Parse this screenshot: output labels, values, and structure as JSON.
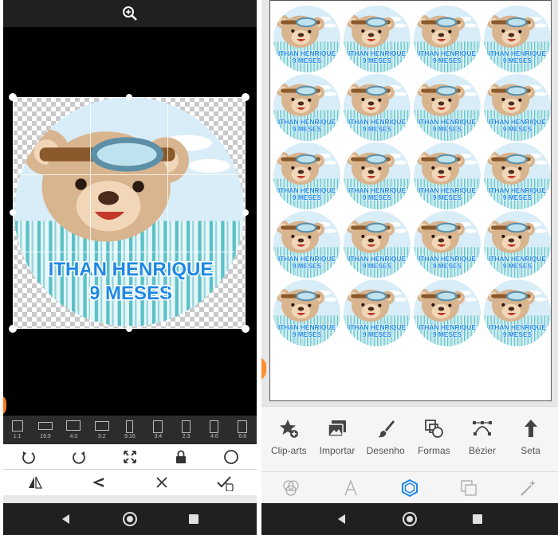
{
  "sticker": {
    "line1": "ITHAN HENRIQUE",
    "line2": "9 MESES"
  },
  "crop_ratios": [
    "1:1",
    "16:9",
    "4:3",
    "3:2",
    "9:16",
    "3:4",
    "2:3",
    "4:6",
    "6:8"
  ],
  "toolbar": {
    "items": [
      "Clip-arts",
      "Importar",
      "Desenho",
      "Formas",
      "Bézier",
      "Seta"
    ]
  },
  "colors": {
    "accent": "#1e88e5",
    "sticker_text": "#1e88e5",
    "stripe_teal": "#5bc0c8",
    "sky": "#d8edf7",
    "bear": "#d8b48f"
  }
}
